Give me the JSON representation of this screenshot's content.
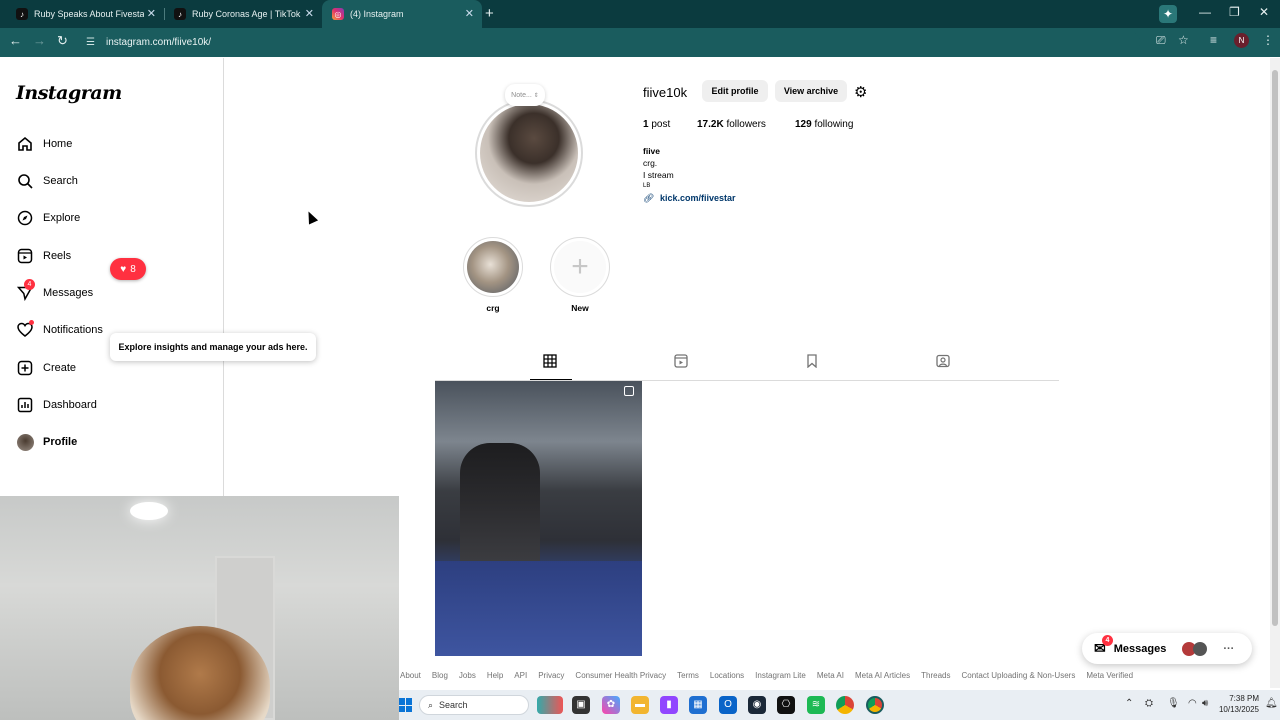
{
  "browser": {
    "tabs": [
      {
        "title": "Ruby Speaks About Fivestar Or..."
      },
      {
        "title": "Ruby Coronas Age | TikTok"
      },
      {
        "title": "(4) Instagram"
      }
    ],
    "url": "instagram.com/fiive10k/",
    "profile_initial": "N"
  },
  "sidebar": {
    "logo": "Instagram",
    "items": [
      {
        "label": "Home"
      },
      {
        "label": "Search"
      },
      {
        "label": "Explore"
      },
      {
        "label": "Reels"
      },
      {
        "label": "Messages",
        "badge": "4"
      },
      {
        "label": "Notifications"
      },
      {
        "label": "Create"
      },
      {
        "label": "Dashboard"
      },
      {
        "label": "Profile"
      }
    ],
    "notif_count": "8",
    "tooltip": "Explore insights and manage your ads here."
  },
  "profile": {
    "note": "Note...",
    "username": "fiive10k",
    "edit_profile": "Edit profile",
    "view_archive": "View archive",
    "posts_count": "1",
    "posts_label": "post",
    "followers_count": "17.2K",
    "followers_label": "followers",
    "following_count": "129",
    "following_label": "following",
    "bio_name": "fiive",
    "bio_line1": "crg.",
    "bio_line2": "I stream",
    "bio_line3": "LB",
    "link": "kick.com/fiivestar"
  },
  "highlights": [
    {
      "label": "crg"
    },
    {
      "label": "New"
    }
  ],
  "footer": [
    "About",
    "Blog",
    "Jobs",
    "Help",
    "API",
    "Privacy",
    "Consumer Health Privacy",
    "Terms",
    "Locations",
    "Instagram Lite",
    "Meta AI",
    "Meta AI Articles",
    "Threads",
    "Contact Uploading & Non-Users",
    "Meta Verified"
  ],
  "messages_bubble": {
    "label": "Messages",
    "badge": "4"
  },
  "taskbar": {
    "search": "Search",
    "time": "7:38 PM",
    "date": "10/13/2025"
  },
  "colors": {
    "chrome_dark": "#0b3b3f",
    "chrome_toolbar": "#1a5c5e",
    "ig_red": "#ff3040",
    "link": "#00376b"
  }
}
